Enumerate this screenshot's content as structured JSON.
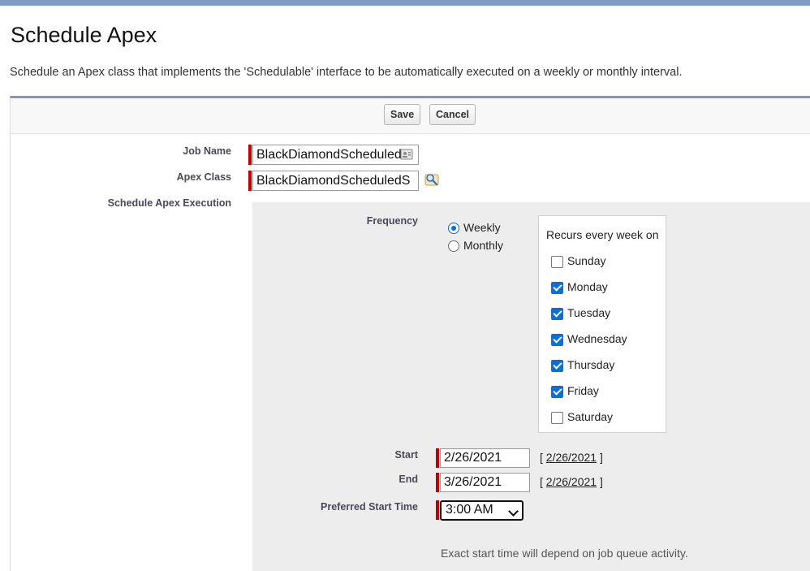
{
  "page": {
    "title": "Schedule Apex",
    "description": "Schedule an Apex class that implements the 'Schedulable' interface to be automatically executed on a weekly or monthly interval."
  },
  "toolbar": {
    "save_label": "Save",
    "cancel_label": "Cancel"
  },
  "form": {
    "job_name": {
      "label": "Job Name",
      "value": "BlackDiamondScheduledS"
    },
    "apex_class": {
      "label": "Apex Class",
      "value": "BlackDiamondScheduledS"
    },
    "execution_label": "Schedule Apex Execution",
    "frequency": {
      "label": "Frequency",
      "options": [
        {
          "label": "Weekly",
          "selected": true
        },
        {
          "label": "Monthly",
          "selected": false
        }
      ]
    },
    "recurs_heading": "Recurs every week on",
    "days": [
      {
        "label": "Sunday",
        "checked": false
      },
      {
        "label": "Monday",
        "checked": true
      },
      {
        "label": "Tuesday",
        "checked": true
      },
      {
        "label": "Wednesday",
        "checked": true
      },
      {
        "label": "Thursday",
        "checked": true
      },
      {
        "label": "Friday",
        "checked": true
      },
      {
        "label": "Saturday",
        "checked": false
      }
    ],
    "start": {
      "label": "Start",
      "value": "2/26/2021",
      "link": "2/26/2021"
    },
    "end": {
      "label": "End",
      "value": "3/26/2021",
      "link": "2/26/2021"
    },
    "preferred_time": {
      "label": "Preferred Start Time",
      "value": "3:00 AM"
    },
    "note": "Exact start time will depend on job queue activity.",
    "bracket_open": "[",
    "bracket_close": "]"
  },
  "colors": {
    "required": "#c00000",
    "accent": "#0a6fd8",
    "header_band": "#7d9cc2"
  },
  "icons": {
    "lookup": "magnifier-lookup-icon",
    "field_helper": "contact-card-icon"
  }
}
